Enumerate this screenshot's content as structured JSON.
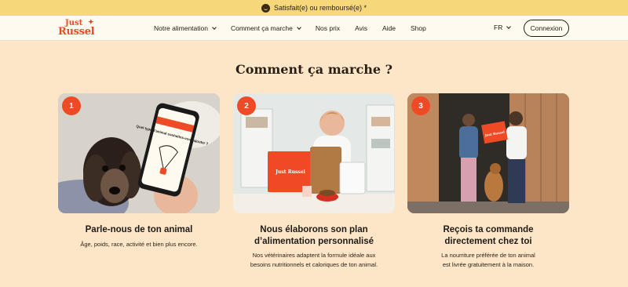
{
  "banner": {
    "text": "Satisfait(e) ou remboursé(e) *"
  },
  "logo": {
    "line1": "Just",
    "line2": "Russel"
  },
  "nav": {
    "items": [
      {
        "label": "Notre alimentation",
        "dropdown": true
      },
      {
        "label": "Comment ça marche",
        "dropdown": true
      },
      {
        "label": "Nos prix",
        "dropdown": false
      },
      {
        "label": "Avis",
        "dropdown": false
      },
      {
        "label": "Aide",
        "dropdown": false
      },
      {
        "label": "Shop",
        "dropdown": false
      }
    ],
    "language": "FR",
    "login_label": "Connexion"
  },
  "section": {
    "title": "Comment ça marche ?",
    "steps": [
      {
        "number": "1",
        "title": "Parle-nous de ton animal",
        "description": "Âge, poids, race, activité et bien plus encore.",
        "phone_text": "Quel type d'animal souhaites-vous ajouter ?"
      },
      {
        "number": "2",
        "title_line1": "Nous élaborons son plan",
        "title_line2": "d’alimentation personnalisé",
        "desc_line1": "Nos vétérinaires adaptent la formule idéale aux",
        "desc_line2": "besoins nutritionnels et caloriques de ton animal.",
        "box_text": "Just Russel"
      },
      {
        "number": "3",
        "title_line1": "Reçois ta commande",
        "title_line2": "directement chez toi",
        "desc_line1": "La nourriture préférée de ton animal",
        "desc_line2": "est livrée gratuitement à la maison.",
        "box_text": "Just Russel"
      }
    ]
  },
  "colors": {
    "accent": "#ee4a25",
    "background": "#fde6c8",
    "banner": "#f6d77a",
    "nav_bg": "#fffaf0"
  }
}
